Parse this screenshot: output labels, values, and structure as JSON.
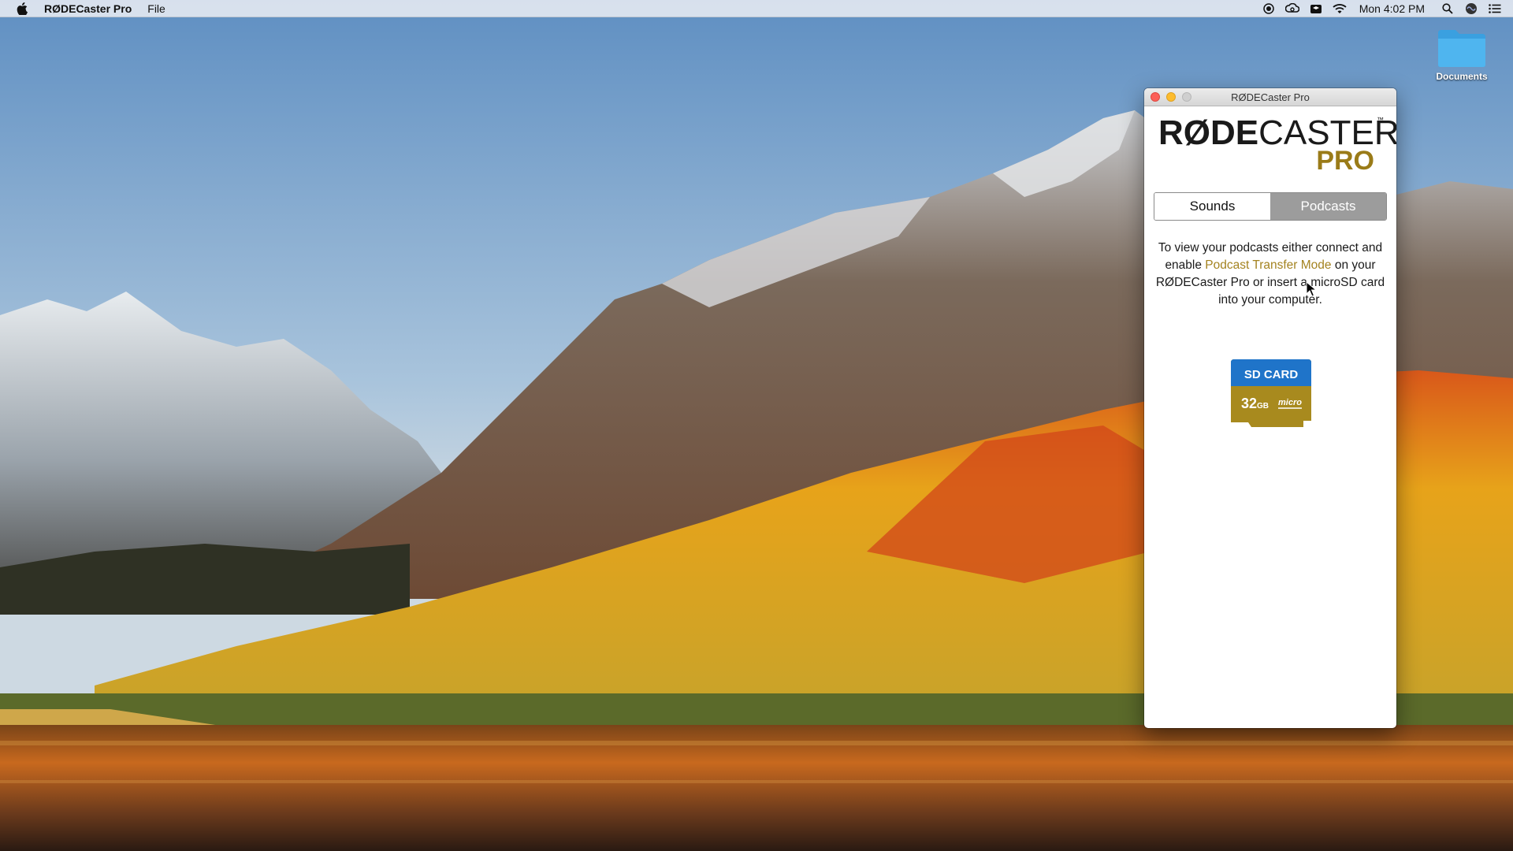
{
  "menubar": {
    "app_name": "RØDECaster Pro",
    "menus": [
      "File"
    ],
    "clock": "Mon 4:02 PM",
    "status_icons": [
      "screen-record-icon",
      "creative-cloud-icon",
      "dropbox-icon",
      "wifi-icon",
      "spotlight-icon",
      "siri-icon",
      "notification-center-icon"
    ]
  },
  "desktop": {
    "icons": [
      {
        "label": "Documents",
        "icon": "folder-icon",
        "color": "#3aa0e0"
      }
    ]
  },
  "window": {
    "title": "RØDECaster Pro",
    "brand": {
      "line1_bold": "RØDE",
      "line1_regular": "CASTER",
      "trademark": "™",
      "line2": "PRO",
      "accent_color": "#9a7b18"
    },
    "tabs": [
      {
        "label": "Sounds",
        "selected": false
      },
      {
        "label": "Podcasts",
        "selected": true
      }
    ],
    "message": {
      "part1": "To view your podcasts either connect and enable ",
      "link": "Podcast Transfer Mode",
      "part2": " on your RØDECaster Pro or insert a microSD card into your computer."
    },
    "sd_card": {
      "top_label": "SD CARD",
      "capacity_number": "32",
      "capacity_unit": "GB",
      "brand_text": "micro",
      "top_color": "#1f74c9",
      "bottom_color": "#a88a1e"
    }
  }
}
